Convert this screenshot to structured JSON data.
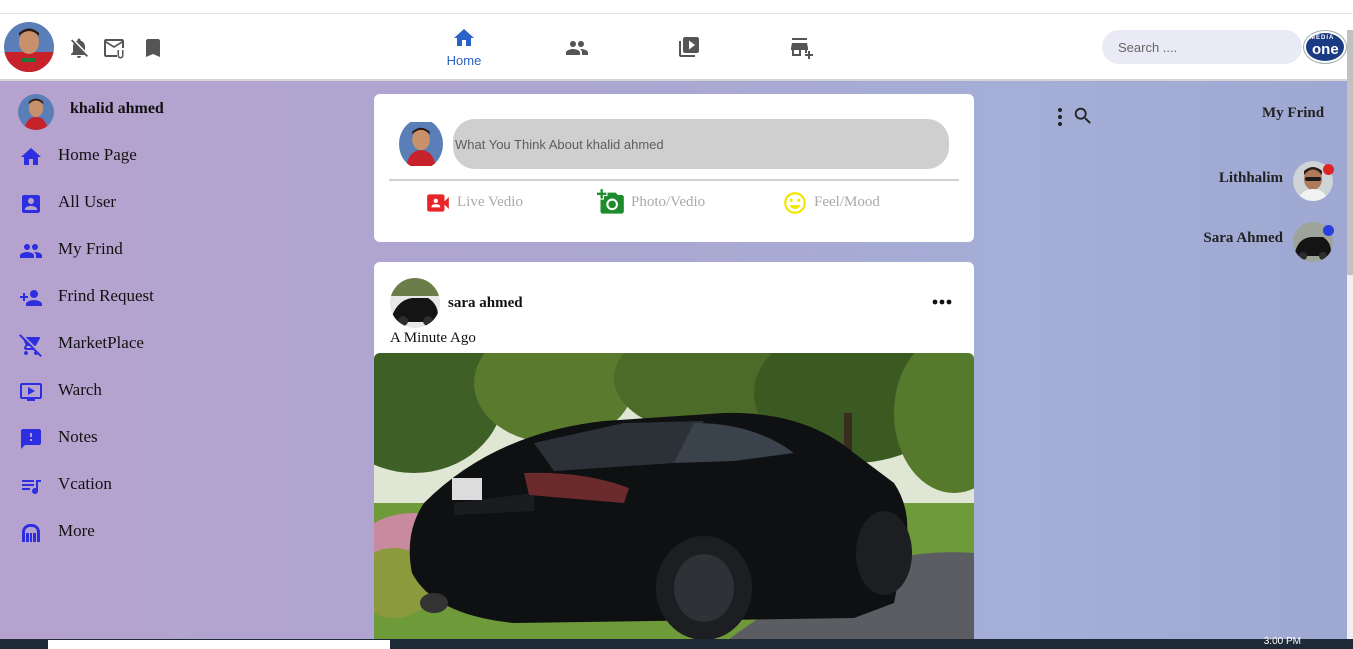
{
  "topbar": {
    "nav": [
      {
        "name": "home",
        "label": "Home",
        "icon": "home-icon"
      },
      {
        "name": "friends",
        "label": "",
        "icon": "people-icon"
      },
      {
        "name": "watch",
        "label": "",
        "icon": "video-library-icon"
      },
      {
        "name": "marketplace",
        "label": "",
        "icon": "add-business-icon"
      }
    ],
    "search_placeholder": "Search ....",
    "brand_top": "MEDIA",
    "brand_bottom": "one"
  },
  "sidebar": {
    "user_name": "khalid ahmed",
    "items": [
      {
        "label": "Home Page",
        "icon": "home-icon"
      },
      {
        "label": "All User",
        "icon": "account-box-icon"
      },
      {
        "label": "My Frind",
        "icon": "people-icon"
      },
      {
        "label": "Frind Request",
        "icon": "person-add-icon"
      },
      {
        "label": "MarketPlace",
        "icon": "cart-off-icon"
      },
      {
        "label": "Warch",
        "icon": "tv-icon"
      },
      {
        "label": "Notes",
        "icon": "feedback-icon"
      },
      {
        "label": "Vcation",
        "icon": "music-icon"
      },
      {
        "label": "More",
        "icon": "more-icon"
      }
    ]
  },
  "composer": {
    "placeholder": "What You Think About khalid ahmed",
    "actions": [
      {
        "label": "Live Vedio",
        "icon": "video-camera-icon",
        "color": "#e8262a"
      },
      {
        "label": "Photo/Vedio",
        "icon": "add-photo-icon",
        "color": "#1e8c2e"
      },
      {
        "label": "Feel/Mood",
        "icon": "smile-icon",
        "color": "#f2e600"
      }
    ]
  },
  "post": {
    "author": "sara ahmed",
    "time": "A Minute Ago",
    "photo": "black suv photo"
  },
  "right": {
    "title": "My Frind",
    "friends": [
      {
        "name": "Lithhalim",
        "status_color": "#e02424"
      },
      {
        "name": "Sara Ahmed",
        "status_color": "#2a3ee0"
      }
    ]
  },
  "taskbar": {
    "time": "3:00 PM"
  },
  "colors": {
    "accent": "#2a62c5",
    "sidebar_icon": "#2c2ee0"
  }
}
